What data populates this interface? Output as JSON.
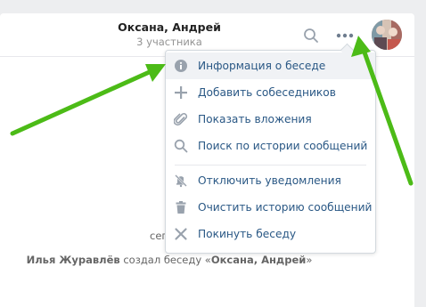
{
  "header": {
    "title": "Оксана, Андрей",
    "subtitle": "3 участника"
  },
  "menu": {
    "items": [
      {
        "label": "Информация о беседе",
        "icon": "info-icon"
      },
      {
        "label": "Добавить собеседников",
        "icon": "plus-icon"
      },
      {
        "label": "Показать вложения",
        "icon": "paperclip-icon"
      },
      {
        "label": "Поиск по истории сообщений",
        "icon": "search-icon"
      },
      {
        "label": "Отключить уведомления",
        "icon": "mute-icon"
      },
      {
        "label": "Очистить историю сообщений",
        "icon": "trash-icon"
      },
      {
        "label": "Покинуть беседу",
        "icon": "close-icon"
      }
    ]
  },
  "chat": {
    "time_fragment": "сег",
    "system_message": {
      "author": "Илья Журавлёв",
      "action": " создал беседу «",
      "chat_name": "Оксана, Андрей",
      "suffix": "»"
    }
  },
  "colors": {
    "accent": "#2a5885",
    "icon": "#99a2ad",
    "arrow": "#4cbb17"
  }
}
